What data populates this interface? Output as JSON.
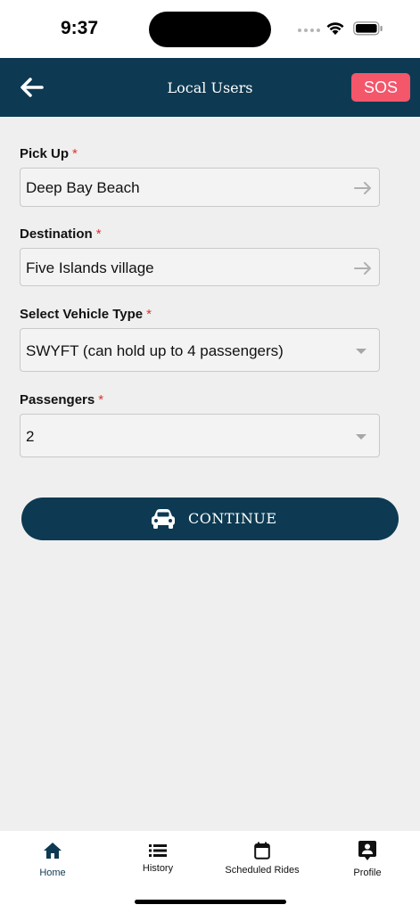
{
  "status": {
    "time": "9:37"
  },
  "header": {
    "title": "Local Users",
    "sos_label": "SOS"
  },
  "form": {
    "pickup": {
      "label": "Pick Up",
      "required_mark": "*",
      "value": "Deep Bay Beach"
    },
    "destination": {
      "label": "Destination",
      "required_mark": "*",
      "value": "Five Islands village"
    },
    "vehicle_type": {
      "label": "Select Vehicle Type",
      "required_mark": "*",
      "value": "SWYFT (can hold up to 4 passengers)"
    },
    "passengers": {
      "label": "Passengers",
      "required_mark": "*",
      "value": "2"
    }
  },
  "continue": {
    "label": "CONTINUE",
    "icon": "car-icon"
  },
  "tabs": [
    {
      "label": "Home",
      "icon": "home-icon",
      "active": true
    },
    {
      "label": "History",
      "icon": "list-icon",
      "active": false
    },
    {
      "label": "Scheduled Rides",
      "icon": "calendar-icon",
      "active": false
    },
    {
      "label": "Profile",
      "icon": "profile-icon",
      "active": false
    }
  ],
  "colors": {
    "primary": "#0d3a52",
    "sos": "#f4566a",
    "required": "#e0312d",
    "background": "#efefef"
  }
}
